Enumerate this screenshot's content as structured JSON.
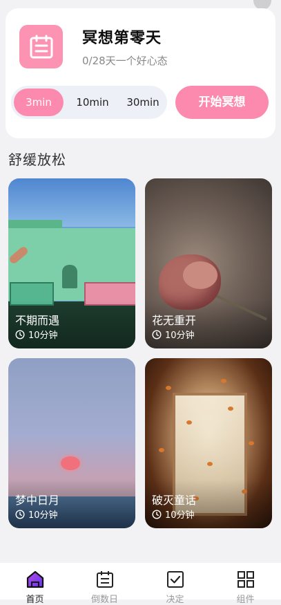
{
  "card": {
    "title": "冥想第零天",
    "subtitle": "0/28天一个好心态",
    "durations": [
      "3min",
      "10min",
      "30min"
    ],
    "selected_duration": "3min",
    "start_label": "开始冥想"
  },
  "section": {
    "title": "舒缓放松"
  },
  "tiles": [
    {
      "title": "不期而遇",
      "duration": "10分钟"
    },
    {
      "title": "花无重开",
      "duration": "10分钟"
    },
    {
      "title": "梦中日月",
      "duration": "10分钟"
    },
    {
      "title": "破灭童话",
      "duration": "10分钟"
    }
  ],
  "nav": [
    {
      "label": "首页",
      "icon": "home-icon",
      "active": true
    },
    {
      "label": "倒数日",
      "icon": "calendar-icon",
      "active": false
    },
    {
      "label": "决定",
      "icon": "checkbox-icon",
      "active": false
    },
    {
      "label": "组件",
      "icon": "grid-icon",
      "active": false
    }
  ],
  "colors": {
    "accent": "#fc89ae",
    "icon_bg": "#fc93b3",
    "home_icon_fill": "#8a3cf0"
  }
}
